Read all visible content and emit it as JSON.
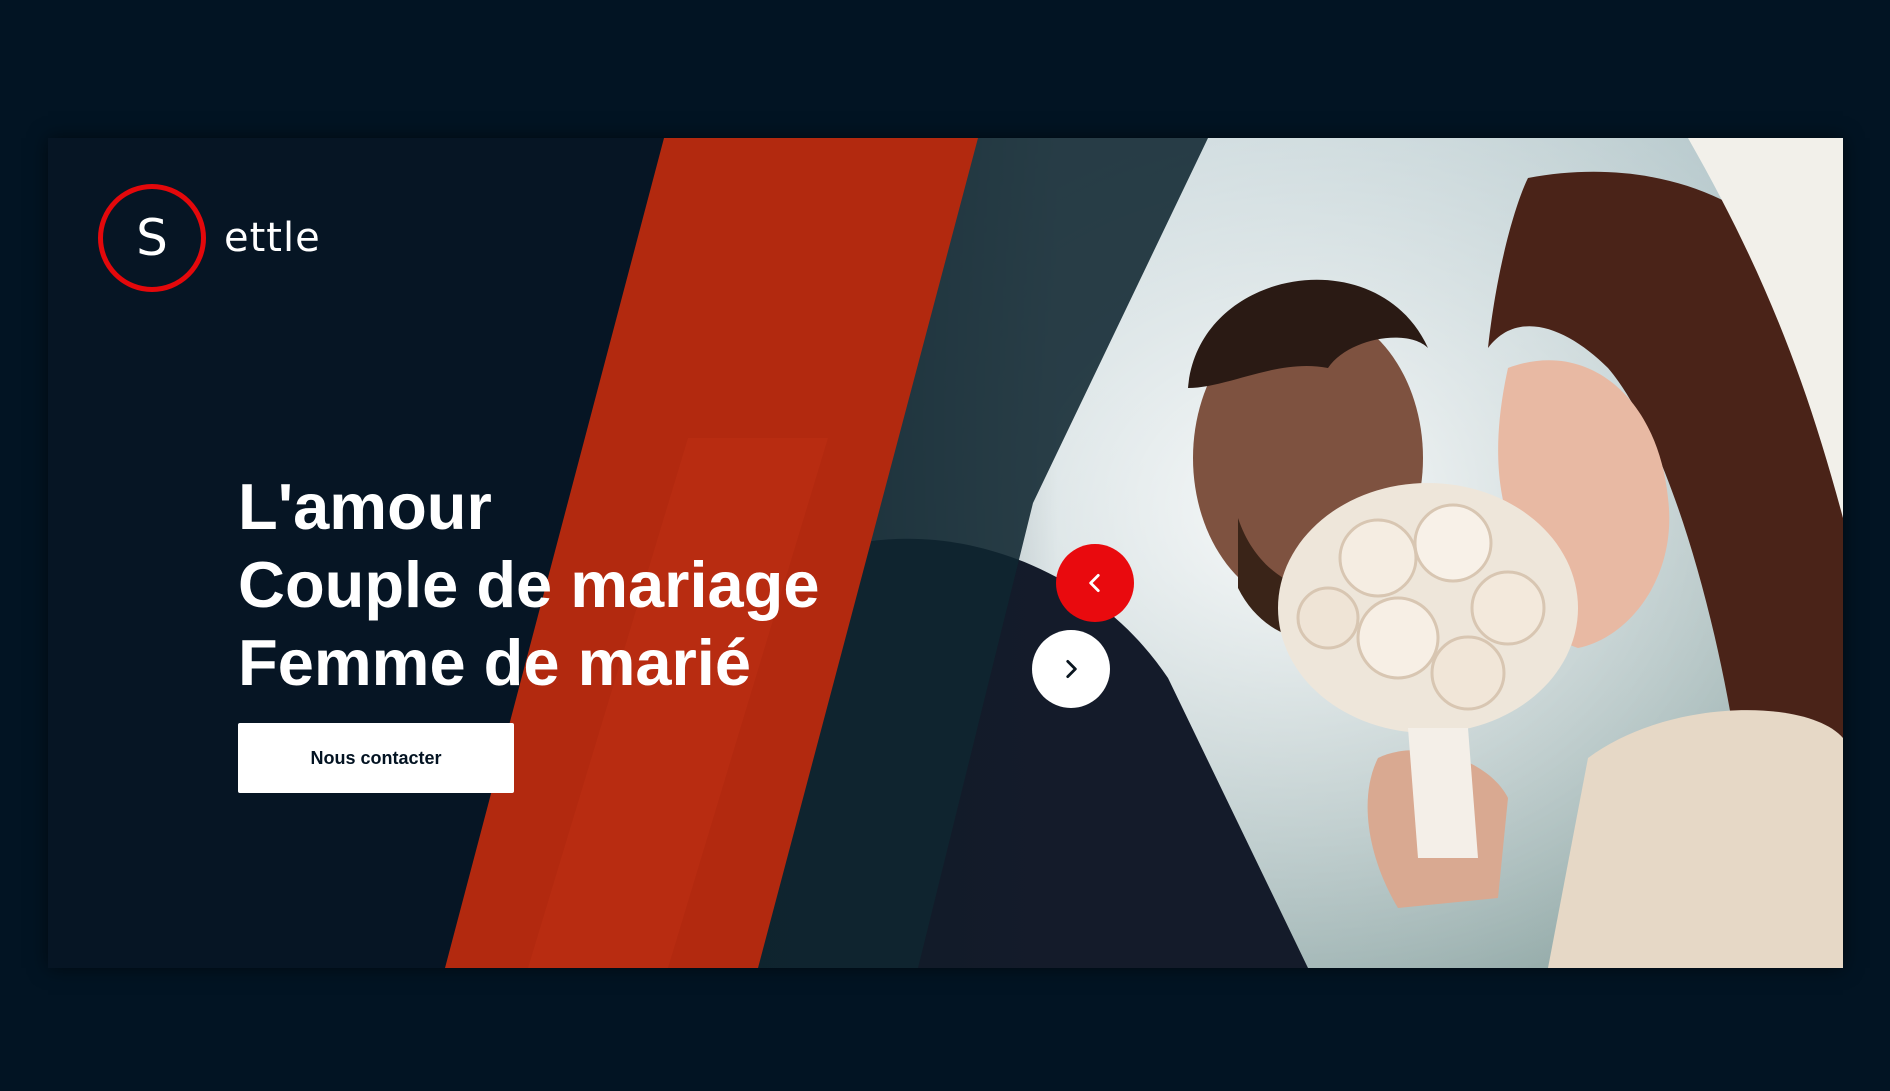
{
  "brand": {
    "logo_letter": "S",
    "logo_text": "ettle"
  },
  "hero": {
    "headline_lines": [
      "L'amour",
      "Couple de mariage",
      "Femme de marié"
    ],
    "cta_label": "Nous contacter",
    "image_icon": "wedding-couple-photo"
  },
  "carousel": {
    "prev_icon": "chevron-left-icon",
    "next_icon": "chevron-right-icon"
  },
  "colors": {
    "background": "#021423",
    "accent_red": "#e4080b",
    "stripe_orange": "#b2290f",
    "white": "#ffffff"
  }
}
